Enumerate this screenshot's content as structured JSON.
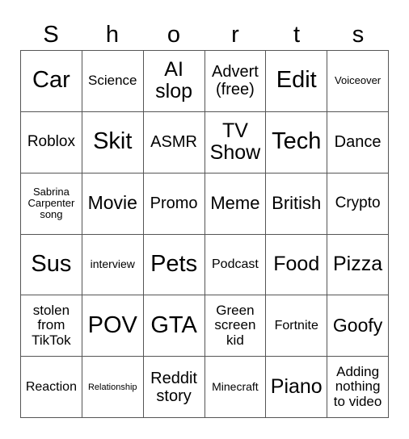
{
  "title_letters": [
    "S",
    "h",
    "o",
    "r",
    "t",
    "s"
  ],
  "cells": [
    [
      "Car",
      "Science",
      "AI slop",
      "Advert (free)",
      "Edit",
      "Voiceover"
    ],
    [
      "Roblox",
      "Skit",
      "ASMR",
      "TV Show",
      "Tech",
      "Dance"
    ],
    [
      "Sabrina Carpenter song",
      "Movie",
      "Promo",
      "Meme",
      "British",
      "Crypto"
    ],
    [
      "Sus",
      "interview",
      "Pets",
      "Podcast",
      "Food",
      "Pizza"
    ],
    [
      "stolen from TikTok",
      "POV",
      "GTA",
      "Green screen kid",
      "Fortnite",
      "Goofy"
    ],
    [
      "Reaction",
      "Relationship",
      "Reddit story",
      "Minecraft",
      "Piano",
      "Adding nothing to video"
    ]
  ]
}
